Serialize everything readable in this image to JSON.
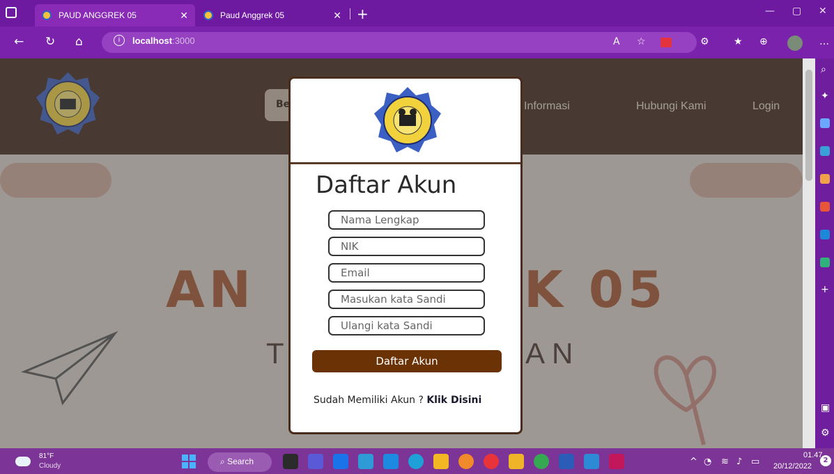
{
  "browser": {
    "tabs": [
      {
        "title": "PAUD ANGGREK 05",
        "active": true
      },
      {
        "title": "Paud Anggrek 05",
        "active": false
      }
    ],
    "url_host": "localhost",
    "url_port": ":3000",
    "accent": "#6e1aa0"
  },
  "site": {
    "nav": {
      "partial_left": "Be",
      "informasi": "Informasi",
      "hubungi": "Hubungi Kami",
      "login": "Login"
    },
    "hero": {
      "big_left": "AN",
      "big_right": "K 05",
      "sub_left": "T",
      "sub_right": "AN"
    },
    "header_color": "#43291a"
  },
  "modal": {
    "title": "Daftar Akun",
    "fields": {
      "nama": "Nama Lengkap",
      "nik": "NIK",
      "email": "Email",
      "sandi": "Masukan kata Sandi",
      "ulangi": "Ulangi kata Sandi"
    },
    "submit_label": "Daftar Akun",
    "prompt_text": "Sudah Memiliki Akun ? ",
    "prompt_link": "Klik Disini",
    "button_color": "#6b3206"
  },
  "taskbar": {
    "weather_temp": "81°F",
    "weather_cond": "Cloudy",
    "search_label": "Search",
    "time": "01.47",
    "date": "20/12/2022",
    "notifications": "2"
  }
}
